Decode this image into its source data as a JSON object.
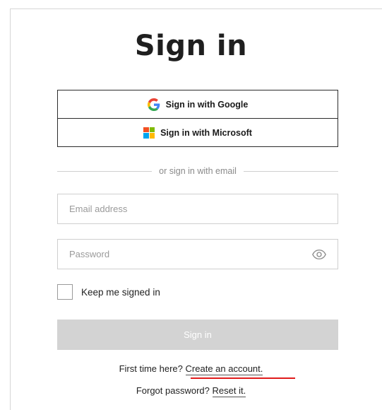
{
  "page": {
    "title": "Sign in"
  },
  "sso": {
    "google_label": "Sign in with Google",
    "google_icon": "google-g-icon",
    "microsoft_label": "Sign in with Microsoft",
    "microsoft_icon": "microsoft-logo-icon"
  },
  "divider": {
    "text": "or sign in with email"
  },
  "form": {
    "email_value": "",
    "email_placeholder": "Email address",
    "password_value": "",
    "password_placeholder": "Password",
    "password_toggle_icon": "eye-icon",
    "keep_signed_in_label": "Keep me signed in",
    "keep_signed_in_checked": false,
    "submit_label": "Sign in"
  },
  "footer": {
    "first_time_text": "First time here?",
    "create_account_link": "Create an account.",
    "forgot_text": "Forgot password?",
    "reset_link": "Reset it."
  },
  "colors": {
    "submit_disabled_bg": "#d3d3d3",
    "annotation_underline": "#e01b1b",
    "google_blue": "#4285F4",
    "google_red": "#EA4335",
    "google_yellow": "#FBBC05",
    "google_green": "#34A853",
    "ms_red": "#F25022",
    "ms_green": "#7FBA00",
    "ms_blue": "#00A4EF",
    "ms_yellow": "#FFB900"
  }
}
